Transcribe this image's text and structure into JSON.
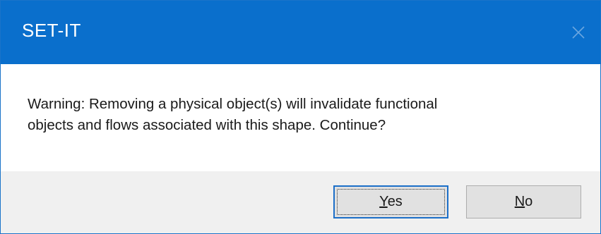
{
  "window": {
    "title": "SET-IT",
    "close_icon": "close-icon"
  },
  "message": {
    "line1": "Warning: Removing a physical object(s) will invalidate functional",
    "line2": "objects and flows associated with this shape. Continue?"
  },
  "buttons": {
    "yes": {
      "mnemonic": "Y",
      "rest": "es"
    },
    "no": {
      "mnemonic": "N",
      "rest": "o"
    }
  },
  "colors": {
    "titlebar": "#0a6fcc",
    "title_text": "#ffffff",
    "footer": "#f0f0f0",
    "button_face": "#e1e1e1",
    "default_button_border": "#1c6fc8"
  }
}
